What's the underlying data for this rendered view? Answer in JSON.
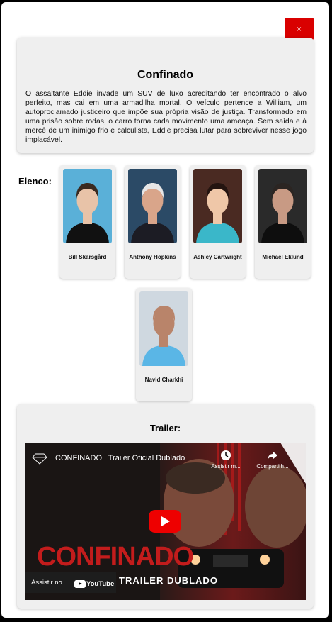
{
  "close_label": "×",
  "movie": {
    "title": "Confinado",
    "synopsis": "O assaltante Eddie invade um SUV de luxo acreditando ter encontrado o alvo perfeito, mas cai em uma armadilha mortal. O veículo pertence a William, um autoproclamado justiceiro que impõe sua própria visão de justiça. Transformado em uma prisão sobre rodas, o carro torna cada movimento uma ameaça. Sem saída e à mercê de um inimigo frio e calculista, Eddie precisa lutar para sobreviver nesse jogo implacável."
  },
  "cast": {
    "label": "Elenco:",
    "actors": [
      {
        "name": "Bill Skarsgård",
        "photo_bg": "#5ab0d8",
        "skin": "#e8c3a8",
        "hair": "#3a2a20",
        "shirt": "#111111"
      },
      {
        "name": "Anthony Hopkins",
        "photo_bg": "#2b4a66",
        "skin": "#d9a58a",
        "hair": "#e6e6e6",
        "shirt": "#1c1c24"
      },
      {
        "name": "Ashley Cartwright",
        "photo_bg": "#4a2a22",
        "skin": "#efc7a8",
        "hair": "#241410",
        "shirt": "#3ab7c9"
      },
      {
        "name": "Michael Eklund",
        "photo_bg": "#2a2a2a",
        "skin": "#c89a84",
        "hair": "#2b2522",
        "shirt": "#0e0e0e"
      },
      {
        "name": "Navid Charkhi",
        "photo_bg": "#cfd8e0",
        "skin": "#b9846a",
        "hair": "#b9846a",
        "shirt": "#5ab6e6"
      }
    ]
  },
  "trailer": {
    "label": "Trailer:",
    "video_title": "CONFINADO | Trailer Oficial Dublado",
    "watch_later": "Assistir m...",
    "share": "Compartilh...",
    "big_title": "CONFINADO",
    "sub_title": "TRAILER DUBLADO",
    "watch_on": "Assistir no",
    "youtube": "YouTube"
  },
  "colors": {
    "accent": "#d90000",
    "card_bg": "#efefef"
  }
}
